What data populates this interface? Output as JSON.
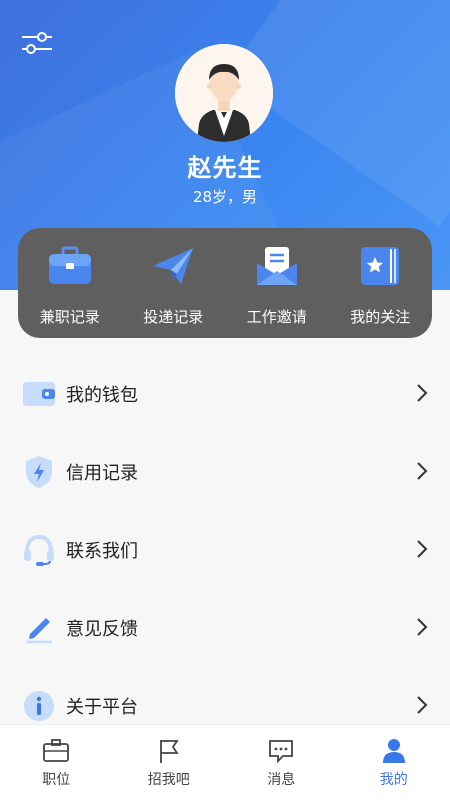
{
  "profile": {
    "name": "赵先生",
    "info": "28岁，男"
  },
  "quick_actions": [
    {
      "label": "兼职记录",
      "icon": "briefcase-icon"
    },
    {
      "label": "投递记录",
      "icon": "paper-plane-icon"
    },
    {
      "label": "工作邀请",
      "icon": "envelope-icon"
    },
    {
      "label": "我的关注",
      "icon": "bookmark-star-icon"
    }
  ],
  "menu": [
    {
      "label": "我的钱包",
      "icon": "wallet-icon"
    },
    {
      "label": "信用记录",
      "icon": "credit-shield-icon"
    },
    {
      "label": "联系我们",
      "icon": "headset-icon"
    },
    {
      "label": "意见反馈",
      "icon": "pen-icon"
    },
    {
      "label": "关于平台",
      "icon": "info-icon"
    }
  ],
  "tabs": [
    {
      "label": "职位",
      "icon": "briefcase-icon",
      "active": false
    },
    {
      "label": "招我吧",
      "icon": "flag-icon",
      "active": false
    },
    {
      "label": "消息",
      "icon": "chat-icon",
      "active": false
    },
    {
      "label": "我的",
      "icon": "person-icon",
      "active": true
    }
  ],
  "colors": {
    "hero_start": "#3f6fdc",
    "hero_end": "#4a95f5",
    "quick_panel": "#5f5f5f",
    "accent": "#3a78e8",
    "page_background": "#f7f7f7"
  }
}
